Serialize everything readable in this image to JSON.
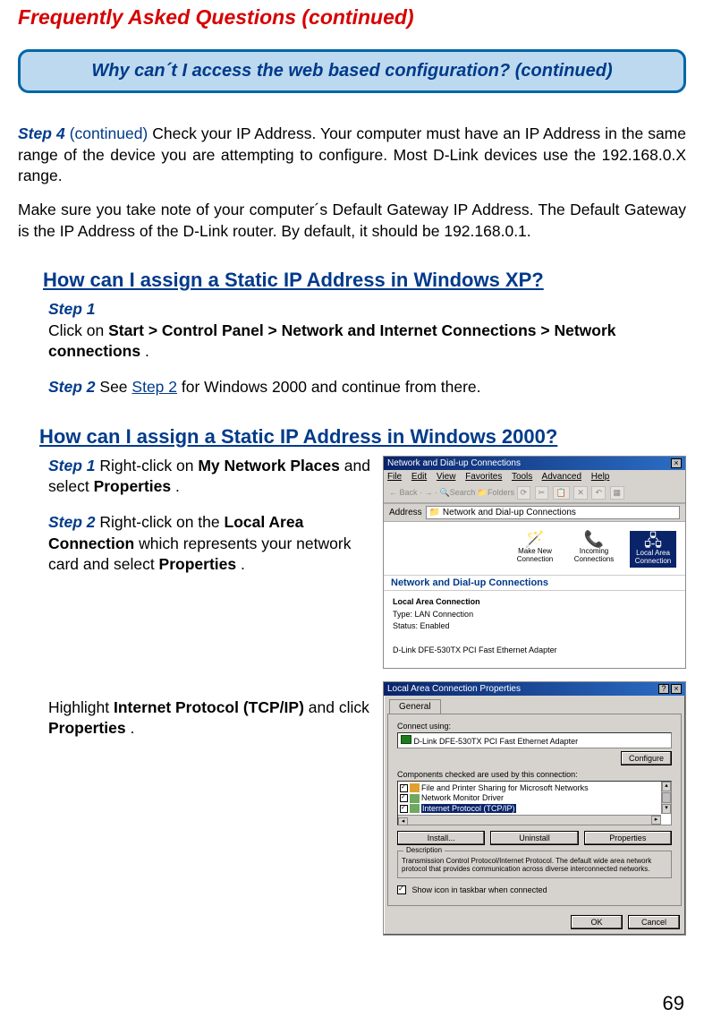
{
  "pageTitle": "Frequently Asked Questions (continued)",
  "questionBox": "Why can´t I access the web based configuration? (continued)",
  "step4": {
    "label": "Step 4",
    "continued": "(continued)",
    "textA": " Check your IP Address. Your computer must have an IP Address in the same range of the device you are attempting to configure. Most D-Link devices use the 192.168.0.X range.",
    "textB": "Make sure you take note of your computer´s Default Gateway IP Address. The Default Gateway is the IP Address of the D-Link router. By default, it should be 192.168.0.1."
  },
  "xp": {
    "heading": "How can I assign a Static IP Address in Windows XP?",
    "step1": {
      "label": "Step 1",
      "pre": "Click on ",
      "path": "Start > Control Panel > Network and Internet Connections > Network connections",
      "post": "."
    },
    "step2": {
      "label": "Step 2",
      "pre": " See ",
      "link": "Step 2",
      "post": " for Windows 2000 and continue from there."
    }
  },
  "w2k": {
    "heading": "How can I assign a Static IP Address in Windows 2000?",
    "step1": {
      "label": "Step 1",
      "pre": " Right-click on ",
      "b1": "My Network Places",
      "mid": " and select ",
      "b2": "Properties",
      "post": "."
    },
    "step2": {
      "label": "Step 2",
      "pre": " Right-click on the ",
      "b1": "Local Area Connection",
      "mid": " which represents your network card and select ",
      "b2": "Properties",
      "post": "."
    },
    "highlight": {
      "pre": "Highlight ",
      "b1": "Internet Protocol (TCP/IP)",
      "mid": " and click ",
      "b2": "Properties",
      "post": "."
    }
  },
  "nduWindow": {
    "title": "Network and Dial-up Connections",
    "menu": {
      "file": "File",
      "edit": "Edit",
      "view": "View",
      "favorites": "Favorites",
      "tools": "Tools",
      "advanced": "Advanced",
      "help": "Help"
    },
    "toolbar": {
      "back": "Back",
      "search": "Search",
      "folders": "Folders"
    },
    "addressLabel": "Address",
    "addressValue": "Network and Dial-up Connections",
    "panelTitle": "Network and Dial-up Connections",
    "icons": {
      "makeNew": "Make New Connection",
      "incoming": "Incoming Connections",
      "lan": "Local Area Connection"
    },
    "details": {
      "name": "Local Area Connection",
      "typeLabel": "Type:",
      "type": "LAN Connection",
      "statusLabel": "Status:",
      "status": "Enabled",
      "adapter": "D-Link DFE-530TX PCI Fast Ethernet Adapter"
    }
  },
  "propsWindow": {
    "title": "Local Area Connection Properties",
    "tab": "General",
    "connectUsing": "Connect using:",
    "adapter": "D-Link DFE-530TX PCI Fast Ethernet Adapter",
    "configure": "Configure",
    "componentsLabel": "Components checked are used by this connection:",
    "items": {
      "a": "File and Printer Sharing for Microsoft Networks",
      "b": "Network Monitor Driver",
      "c": "Internet Protocol (TCP/IP)"
    },
    "install": "Install...",
    "uninstall": "Uninstall",
    "properties": "Properties",
    "descLegend": "Description",
    "desc": "Transmission Control Protocol/Internet Protocol. The default wide area network protocol that provides communication across diverse interconnected networks.",
    "showIcon": "Show icon in taskbar when connected",
    "ok": "OK",
    "cancel": "Cancel"
  },
  "pageNumber": "69"
}
